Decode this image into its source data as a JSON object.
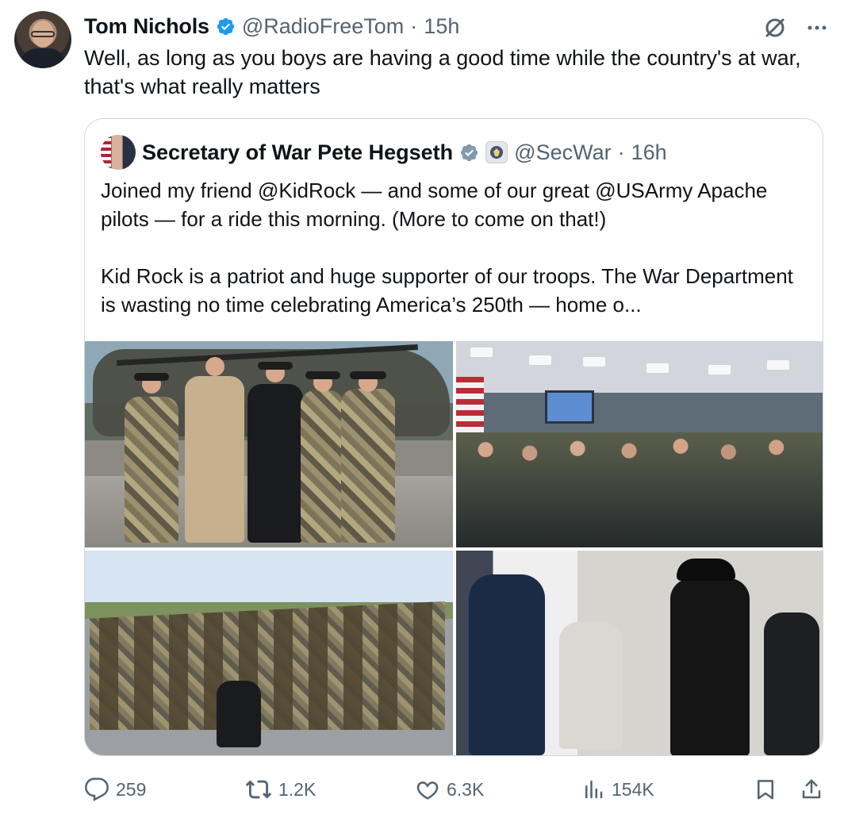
{
  "tweet": {
    "author": {
      "name": "Tom Nichols",
      "handle": "@RadioFreeTom",
      "time": "15h",
      "avatar": "tom-nichols-avatar"
    },
    "text": "Well, as long as you boys are having a good time while the country's at war, that's what really matters",
    "icons": {
      "grok": "grok-icon",
      "more": "more-icon",
      "verified": "verified-icon"
    },
    "separator": "·"
  },
  "quote": {
    "author": {
      "name": "Secretary of War Pete Hegseth",
      "handle": "@SecWar",
      "time": "16h",
      "avatar": "pete-hegseth-avatar",
      "affiliate_badge": "department-seal-icon"
    },
    "paragraphs": [
      "Joined my friend @KidRock — and some of our great @USArmy Apache pilots — for a ride this morning. (More to come on that!)",
      "Kid Rock is a patriot and huge supporter of our troops. The War Department is wasting no time celebrating America’s 250th — home o..."
    ],
    "media": [
      "photo-group-with-apache-helicopter",
      "photo-briefing-room-audience",
      "photo-army-group-outdoors",
      "photo-indoor-greeting"
    ]
  },
  "actions": {
    "reply": {
      "count": "259",
      "icon": "reply-icon"
    },
    "retweet": {
      "count": "1.2K",
      "icon": "retweet-icon"
    },
    "like": {
      "count": "6.3K",
      "icon": "heart-icon"
    },
    "views": {
      "count": "154K",
      "icon": "analytics-icon"
    },
    "bookmark": {
      "icon": "bookmark-icon"
    },
    "share": {
      "icon": "share-icon"
    }
  },
  "colors": {
    "text": "#0f1419",
    "secondary": "#536471",
    "border": "#cfd9de",
    "verified_blue": "#1d9bf0",
    "verified_gray": "#829aab"
  }
}
